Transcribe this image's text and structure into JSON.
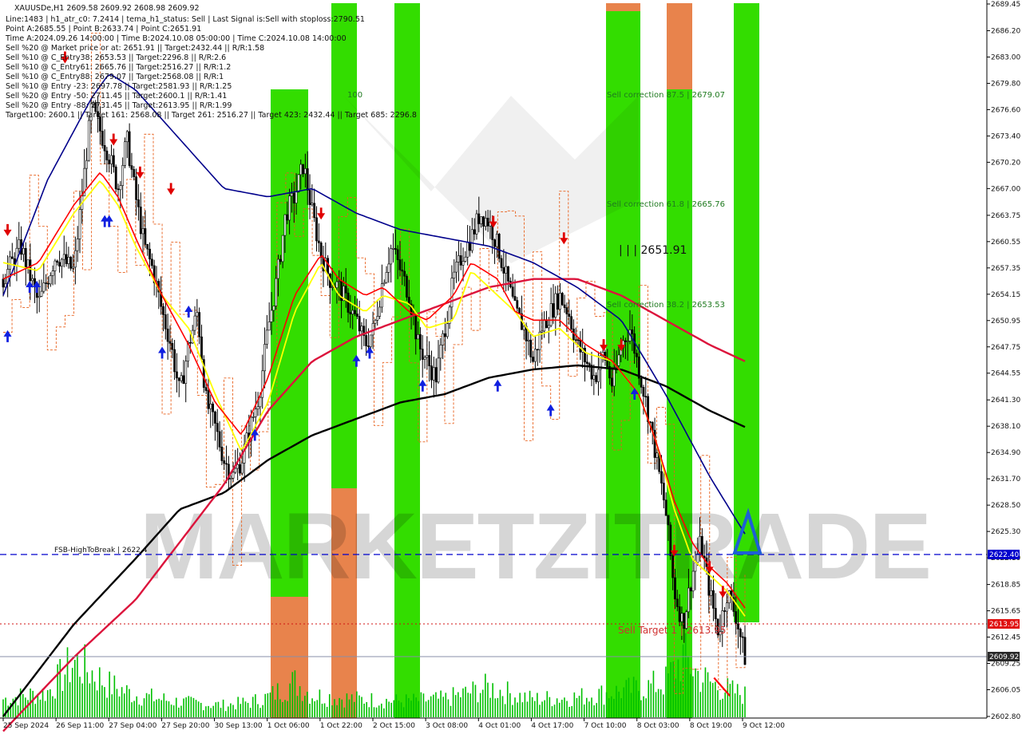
{
  "header": {
    "symbol_line": "XAUUSDe,H1  2609.58 2609.92 2608.98 2609.92",
    "lines": [
      "Line:1483  |  h1_atr_c0: 7.2414  |  tema_h1_status: Sell  |  Last Signal is:Sell with stoploss:2790.51",
      "Point A:2685.55  |  Point B:2633.74  |  Point C:2651.91",
      "Time A:2024.09.26 14:00:00  |  Time B:2024.10.08 05:00:00  |  Time C:2024.10.08 14:00:00",
      "Sell %20 @ Market price or at: 2651.91  ||  Target:2432.44  ||  R/R:1.58",
      "Sell %10 @ C_Entry38: 2653.53  ||  Target:2296.8  ||  R/R:2.6",
      "Sell %10 @ C_Entry61: 2665.76  ||  Target:2516.27  ||  R/R:1.2",
      "Sell %10 @ C_Entry88: 2679.07  ||  Target:2568.08  ||  R/R:1",
      "Sell %10 @ Entry -23: 2697.78  ||  Target:2581.93  ||  R/R:1.25",
      "Sell %20 @ Entry -50: 2711.45  ||  Target:2600.1  ||  R/R:1.41",
      "Sell %20 @ Entry -88: 2731.45  ||  Target:2613.95  ||  R/R:1.99",
      "Target100: 2600.1  ||  Target 161: 2568.08  ||  Target 261: 2516.27  ||  Target 423: 2432.44  ||  Target 685: 2296.8"
    ]
  },
  "labels": {
    "sell_correction_875": "Sell correction 87.5 | 2679.07",
    "sell_correction_618": "Sell correction 61.8 | 2665.76",
    "sell_correction_382": "Sell correction 38.2 | 2653.53",
    "point_c": "| | | 2651.91",
    "fsb": "FSB-HighToBreak | 2622.4",
    "sell_target": "Sell Target 1 | 2613.95",
    "hundred": "100",
    "watermark": "MARKETZITRADE"
  },
  "price_tags": {
    "fsb": "2622.40",
    "target": "2613.95",
    "current": "2609.92"
  },
  "colors": {
    "green_zone": "#33dd00",
    "orange_zone": "#e8834c",
    "candle": "#000000",
    "ema_black": "#000000",
    "ema_crimson": "#dc143c",
    "ma_navy": "#00008b",
    "yellow": "#ffff00",
    "red": "#ff0000",
    "volume": "#00c000",
    "dashed_blue": "#0000cd",
    "dotted_red": "#d01010",
    "target_tag": "#e01010",
    "fsb_tag": "#0000cd",
    "current_tag": "#2a2a2a"
  },
  "chart_data": {
    "type": "candlestick",
    "symbol": "XAUUSDe",
    "timeframe": "H1",
    "ylim": [
      2602.8,
      2689.45
    ],
    "y_ticks": [
      "2689.45",
      "2686.20",
      "2683.00",
      "2679.80",
      "2676.60",
      "2673.40",
      "2670.20",
      "2667.00",
      "2663.75",
      "2660.55",
      "2657.35",
      "2654.15",
      "2650.95",
      "2647.75",
      "2644.55",
      "2641.30",
      "2638.10",
      "2634.90",
      "2631.70",
      "2628.50",
      "2625.30",
      "2622.10",
      "2618.85",
      "2615.65",
      "2612.45",
      "2609.25",
      "2606.05",
      "2602.80"
    ],
    "x_ticks": [
      "25 Sep 2024",
      "26 Sep 11:00",
      "27 Sep 04:00",
      "27 Sep 20:00",
      "30 Sep 13:00",
      "1 Oct 06:00",
      "1 Oct 22:00",
      "2 Oct 15:00",
      "3 Oct 08:00",
      "4 Oct 01:00",
      "4 Oct 17:00",
      "7 Oct 10:00",
      "8 Oct 03:00",
      "8 Oct 19:00",
      "9 Oct 12:00"
    ],
    "levels": {
      "fsb_high_to_break": 2622.4,
      "sell_target_1": 2613.95,
      "current_price": 2609.92,
      "sell_correction_875": 2679.07,
      "sell_correction_618": 2665.76,
      "sell_correction_382": 2653.53,
      "point_c": 2651.91
    },
    "price_path": [
      [
        0,
        2656
      ],
      [
        2,
        2660
      ],
      [
        4,
        2653
      ],
      [
        6,
        2659
      ],
      [
        8,
        2657
      ],
      [
        9,
        2667
      ],
      [
        10,
        2677
      ],
      [
        11,
        2674
      ],
      [
        12,
        2671
      ],
      [
        13,
        2667
      ],
      [
        14,
        2673
      ],
      [
        15,
        2666
      ],
      [
        16,
        2660
      ],
      [
        17,
        2657
      ],
      [
        18,
        2652
      ],
      [
        19,
        2648
      ],
      [
        20,
        2642
      ],
      [
        21,
        2648
      ],
      [
        22,
        2652
      ],
      [
        23,
        2641
      ],
      [
        24,
        2638
      ],
      [
        25,
        2634
      ],
      [
        26,
        2632
      ],
      [
        27,
        2634
      ],
      [
        28,
        2638
      ],
      [
        29,
        2642
      ],
      [
        30,
        2650
      ],
      [
        31,
        2656
      ],
      [
        32,
        2664
      ],
      [
        33,
        2666
      ],
      [
        34,
        2670
      ],
      [
        35,
        2664
      ],
      [
        36,
        2659
      ],
      [
        37,
        2656
      ],
      [
        38,
        2655
      ],
      [
        39,
        2653
      ],
      [
        40,
        2651
      ],
      [
        41,
        2648
      ],
      [
        42,
        2650
      ],
      [
        43,
        2656
      ],
      [
        44,
        2660
      ],
      [
        45,
        2657
      ],
      [
        46,
        2654
      ],
      [
        47,
        2648
      ],
      [
        48,
        2646
      ],
      [
        49,
        2644
      ],
      [
        50,
        2650
      ],
      [
        51,
        2656
      ],
      [
        52,
        2659
      ],
      [
        53,
        2661
      ],
      [
        54,
        2664
      ],
      [
        55,
        2663
      ],
      [
        56,
        2660
      ],
      [
        57,
        2656
      ],
      [
        58,
        2652
      ],
      [
        59,
        2650
      ],
      [
        60,
        2646
      ],
      [
        61,
        2650
      ],
      [
        62,
        2652
      ],
      [
        63,
        2654
      ],
      [
        64,
        2652
      ],
      [
        65,
        2648
      ],
      [
        66,
        2646
      ],
      [
        67,
        2644
      ],
      [
        68,
        2647
      ],
      [
        69,
        2643
      ],
      [
        70,
        2648
      ],
      [
        71,
        2650
      ],
      [
        72,
        2645
      ],
      [
        73,
        2640
      ],
      [
        74,
        2634
      ],
      [
        75,
        2628
      ],
      [
        76,
        2618
      ],
      [
        77,
        2614
      ],
      [
        78,
        2620
      ],
      [
        79,
        2624
      ],
      [
        80,
        2618
      ],
      [
        81,
        2613
      ],
      [
        82,
        2618
      ],
      [
        83,
        2615
      ],
      [
        84,
        2610
      ]
    ],
    "volume_path": [
      [
        0,
        0.18
      ],
      [
        5,
        0.25
      ],
      [
        8,
        0.55
      ],
      [
        10,
        0.45
      ],
      [
        12,
        0.32
      ],
      [
        15,
        0.22
      ],
      [
        18,
        0.18
      ],
      [
        20,
        0.15
      ],
      [
        25,
        0.12
      ],
      [
        28,
        0.15
      ],
      [
        30,
        0.2
      ],
      [
        33,
        0.35
      ],
      [
        35,
        0.22
      ],
      [
        40,
        0.18
      ],
      [
        45,
        0.16
      ],
      [
        50,
        0.18
      ],
      [
        55,
        0.3
      ],
      [
        58,
        0.22
      ],
      [
        60,
        0.18
      ],
      [
        65,
        0.2
      ],
      [
        70,
        0.26
      ],
      [
        73,
        0.3
      ],
      [
        75,
        0.35
      ],
      [
        77,
        0.6
      ],
      [
        79,
        0.4
      ],
      [
        81,
        0.3
      ],
      [
        84,
        0.22
      ]
    ],
    "series": [
      {
        "name": "",
        "kind": "ema200_black",
        "path": [
          [
            0,
            2602.8
          ],
          [
            8,
            2614
          ],
          [
            15,
            2622
          ],
          [
            20,
            2628
          ],
          [
            25,
            2630
          ],
          [
            30,
            2634
          ],
          [
            35,
            2637
          ],
          [
            40,
            2639
          ],
          [
            45,
            2641
          ],
          [
            50,
            2642
          ],
          [
            55,
            2644
          ],
          [
            60,
            2645
          ],
          [
            65,
            2645.5
          ],
          [
            70,
            2645
          ],
          [
            75,
            2643
          ],
          [
            80,
            2640
          ],
          [
            84,
            2638
          ]
        ]
      },
      {
        "name": "",
        "kind": "ema100_crimson",
        "path": [
          [
            0,
            2601
          ],
          [
            8,
            2610
          ],
          [
            15,
            2617
          ],
          [
            20,
            2624
          ],
          [
            25,
            2631
          ],
          [
            30,
            2640
          ],
          [
            35,
            2646
          ],
          [
            40,
            2649
          ],
          [
            45,
            2651
          ],
          [
            50,
            2653
          ],
          [
            55,
            2655
          ],
          [
            60,
            2656
          ],
          [
            65,
            2656
          ],
          [
            70,
            2654
          ],
          [
            75,
            2651
          ],
          [
            80,
            2648
          ],
          [
            84,
            2646
          ]
        ]
      },
      {
        "name": "",
        "kind": "ma_navy",
        "path": [
          [
            0,
            2654
          ],
          [
            5,
            2668
          ],
          [
            10,
            2678
          ],
          [
            12,
            2681
          ],
          [
            15,
            2679
          ],
          [
            20,
            2673
          ],
          [
            25,
            2667
          ],
          [
            30,
            2666
          ],
          [
            35,
            2667
          ],
          [
            40,
            2664
          ],
          [
            45,
            2662
          ],
          [
            50,
            2661
          ],
          [
            55,
            2660
          ],
          [
            60,
            2658
          ],
          [
            65,
            2655
          ],
          [
            70,
            2651
          ],
          [
            75,
            2642
          ],
          [
            80,
            2632
          ],
          [
            84,
            2625
          ]
        ]
      },
      {
        "name": "",
        "kind": "yellow_fast",
        "path": [
          [
            0,
            2658
          ],
          [
            4,
            2657
          ],
          [
            8,
            2664
          ],
          [
            11,
            2668
          ],
          [
            13,
            2665
          ],
          [
            15,
            2660
          ],
          [
            18,
            2654
          ],
          [
            21,
            2650
          ],
          [
            24,
            2642
          ],
          [
            27,
            2635
          ],
          [
            30,
            2641
          ],
          [
            33,
            2652
          ],
          [
            36,
            2658
          ],
          [
            38,
            2654
          ],
          [
            41,
            2652
          ],
          [
            43,
            2654
          ],
          [
            46,
            2653
          ],
          [
            48,
            2650
          ],
          [
            51,
            2651
          ],
          [
            53,
            2657
          ],
          [
            56,
            2654
          ],
          [
            58,
            2652
          ],
          [
            60,
            2649
          ],
          [
            63,
            2650
          ],
          [
            66,
            2647
          ],
          [
            69,
            2646
          ],
          [
            72,
            2642
          ],
          [
            74,
            2636
          ],
          [
            76,
            2628
          ],
          [
            78,
            2622
          ],
          [
            80,
            2620
          ],
          [
            82,
            2618
          ],
          [
            84,
            2615
          ]
        ]
      },
      {
        "name": "",
        "kind": "red_fast",
        "path": [
          [
            0,
            2656
          ],
          [
            4,
            2658
          ],
          [
            8,
            2665
          ],
          [
            11,
            2669
          ],
          [
            13,
            2666
          ],
          [
            15,
            2661
          ],
          [
            18,
            2654
          ],
          [
            21,
            2648
          ],
          [
            24,
            2641
          ],
          [
            27,
            2637
          ],
          [
            30,
            2644
          ],
          [
            33,
            2654
          ],
          [
            36,
            2659
          ],
          [
            38,
            2656
          ],
          [
            41,
            2654
          ],
          [
            43,
            2655
          ],
          [
            46,
            2652
          ],
          [
            48,
            2651
          ],
          [
            51,
            2654
          ],
          [
            53,
            2658
          ],
          [
            56,
            2656
          ],
          [
            58,
            2652
          ],
          [
            60,
            2651
          ],
          [
            63,
            2651
          ],
          [
            66,
            2648
          ],
          [
            69,
            2646
          ],
          [
            72,
            2642
          ],
          [
            74,
            2636
          ],
          [
            76,
            2629
          ],
          [
            78,
            2624
          ],
          [
            80,
            2621
          ],
          [
            82,
            2619
          ],
          [
            84,
            2616
          ]
        ]
      }
    ]
  }
}
